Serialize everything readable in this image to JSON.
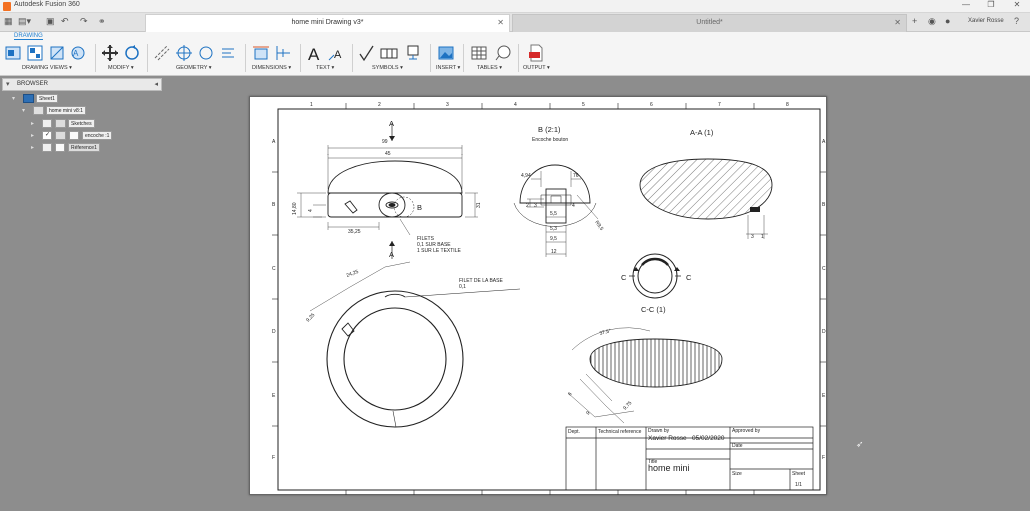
{
  "app": {
    "title": "Autodesk Fusion 360",
    "window_controls": [
      "—",
      "❐",
      "✕"
    ]
  },
  "tabs": [
    {
      "label": "home mini Drawing v3*",
      "active": true
    },
    {
      "label": "Untitled*",
      "active": false
    }
  ],
  "user": {
    "name": "Xavier Rosse"
  },
  "ribbon": {
    "workspace": "DRAWING",
    "groups": [
      "DRAWING VIEWS ▾",
      "MODIFY ▾",
      "GEOMETRY ▾",
      "DIMENSIONS ▾",
      "TEXT ▾",
      "SYMBOLS ▾",
      "INSERT ▾",
      "TABLES ▾",
      "OUTPUT ▾"
    ]
  },
  "browser": {
    "title": "BROWSER",
    "nodes": [
      {
        "label": "Sheet1"
      },
      {
        "label": "home mini v8:1"
      },
      {
        "label": "Sketches"
      },
      {
        "label": "encoche :1"
      },
      {
        "label": "Réference1"
      }
    ]
  },
  "drawing": {
    "view_labels": {
      "a_top": "A",
      "a_bottom": "A",
      "b_callout": "B",
      "detail_b": "B (2:1)",
      "detail_b_sub": "Encoche bouton",
      "section_aa": "A-A (1)",
      "section_cc": "C-C (1)",
      "c_left": "C",
      "c_right": "C"
    },
    "dims": {
      "width_99": "99",
      "width_45": "45",
      "h_14_80": "14,80",
      "h_4": "4",
      "h_31": "31",
      "d_35_25": "35,25",
      "w_4_94": "4,94",
      "w_76": "76",
      "h_2": "2",
      "h_3": "3",
      "h_4b": "4",
      "w_5_5": "5,5",
      "w_5_3": "5,3",
      "w_9_5": "9,5",
      "w_12": "12",
      "r_9_5": "R9,5",
      "h_3b": "3",
      "h_1": "1",
      "d_24_25": "24,25",
      "d_9_25": "9,25",
      "angle": "37,5°",
      "d_6": "6",
      "d_9b": "9",
      "d_9_75": "9,75"
    },
    "notes": {
      "fillet_lines": [
        "FILETS",
        "0,1 SUR BASE",
        "1 SUR LE TEXTILE"
      ],
      "filet_base": "FILET DE LA BASE",
      "filet_base_val": "0,1"
    },
    "title_block": {
      "author": "Xavier Rosse",
      "date": "05/02/2020",
      "title": "home mini",
      "scale": "1/1",
      "label_title": "Title",
      "label_approved": "Approved by",
      "label_drawn": "Drawn by",
      "label_date": "Date",
      "label_dept": "Dept.",
      "label_tech": "Technical reference",
      "label_size": "Size",
      "label_sheet": "Sheet"
    },
    "border_letters": [
      "A",
      "B",
      "C",
      "D",
      "E",
      "F"
    ],
    "border_numbers": [
      "1",
      "2",
      "3",
      "4",
      "5",
      "6",
      "7",
      "8"
    ]
  }
}
